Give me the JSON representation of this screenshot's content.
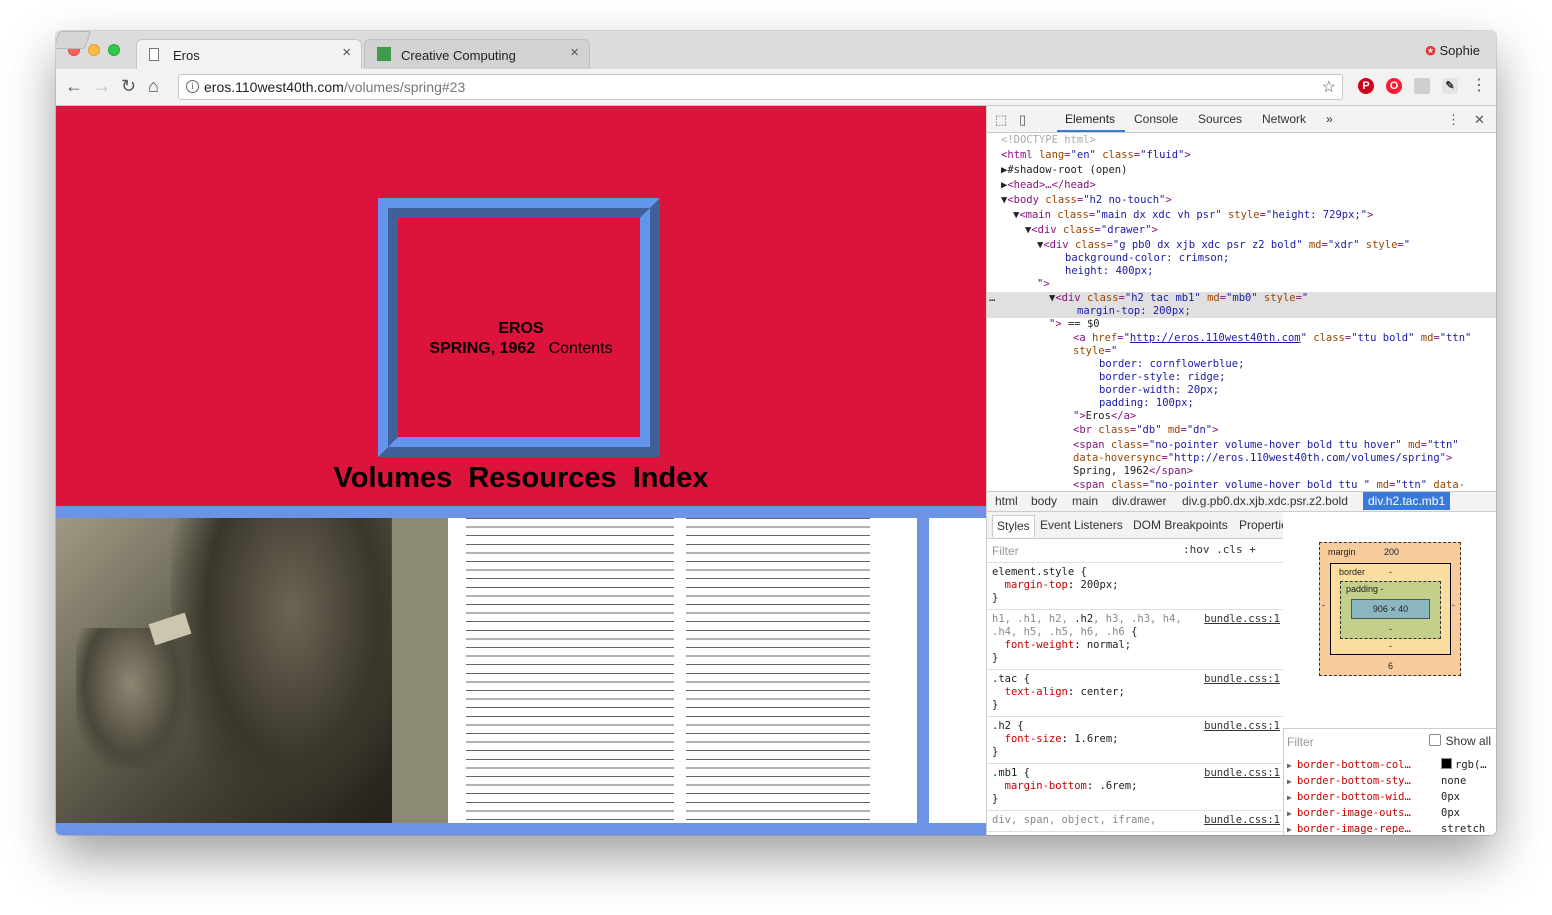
{
  "browser": {
    "tabs": [
      {
        "title": "Eros",
        "close": "×"
      },
      {
        "title": "Creative Computing",
        "close": "×"
      }
    ],
    "profile": "Sophie",
    "url_host": "eros.110west40th.com",
    "url_path": "/volumes/spring#23"
  },
  "page": {
    "logo": "EROS",
    "issue": "SPRING, 1962",
    "contents": "Contents",
    "nav": [
      "Volumes",
      "Resources",
      "Index"
    ],
    "background_color": "crimson",
    "border_color": "cornflowerblue"
  },
  "devtools": {
    "tabs": [
      "Elements",
      "Console",
      "Sources",
      "Network"
    ],
    "more": "»",
    "breadcrumbs": [
      "html",
      "body",
      "main",
      "div.drawer",
      "div.g.pb0.dx.xjb.xdc.psr.z2.bold",
      "div.h2.tac.mb1"
    ],
    "subtabs": [
      "Styles",
      "Event Listeners",
      "DOM Breakpoints",
      "Properties"
    ],
    "styles_filter": "Filter",
    "styles_opts": ":hov  .cls  +",
    "computed_filter": "Filter",
    "show_all": "Show all",
    "box_model": {
      "margin_label": "margin",
      "margin_top": "200",
      "margin_bottom": "6",
      "margin_left": "-",
      "margin_right": "-",
      "border_label": "border",
      "border_val": "-",
      "border_bottom": "-",
      "padding_label": "padding -",
      "padding_bottom": "-",
      "content": "906 × 40"
    },
    "computed": [
      {
        "prop": "border-bottom-col…",
        "value": "rgb(…",
        "swatch": true
      },
      {
        "prop": "border-bottom-sty…",
        "value": "none"
      },
      {
        "prop": "border-bottom-wid…",
        "value": "0px"
      },
      {
        "prop": "border-image-outs…",
        "value": "0px"
      },
      {
        "prop": "border-image-repe…",
        "value": "stretch"
      }
    ]
  }
}
